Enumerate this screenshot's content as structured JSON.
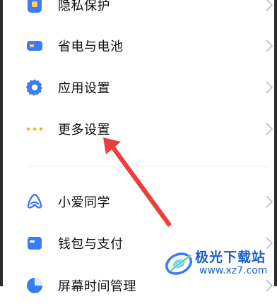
{
  "settings_list": {
    "items": [
      {
        "label": "隐私保护",
        "icon": "privacy-icon"
      },
      {
        "label": "省电与电池",
        "icon": "battery-icon"
      },
      {
        "label": "应用设置",
        "icon": "gear-icon"
      },
      {
        "label": "更多设置",
        "icon": "more-dots-icon"
      },
      {
        "label": "小爱同学",
        "icon": "assistant-icon"
      },
      {
        "label": "钱包与支付",
        "icon": "wallet-icon"
      },
      {
        "label": "屏幕时间管理",
        "icon": "screen-time-icon"
      }
    ]
  },
  "watermark": {
    "title": "极光下载站",
    "url": "www.xz7.com"
  },
  "colors": {
    "accent_blue": "#3a7bf6",
    "dots_yellow": "#f5b800",
    "arrow_red": "#e8403a"
  }
}
